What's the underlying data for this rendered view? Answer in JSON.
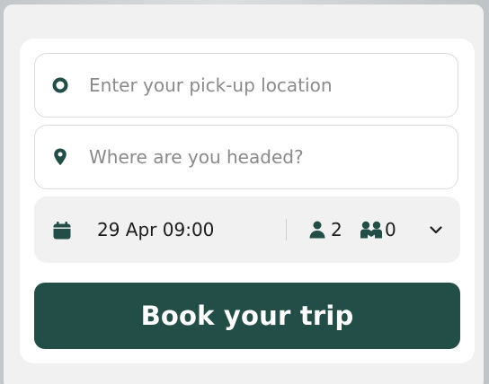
{
  "booking_form": {
    "pickup": {
      "placeholder": "Enter your pick-up location",
      "value": "",
      "icon": "origin-circle-icon"
    },
    "destination": {
      "placeholder": "Where are you headed?",
      "value": "",
      "icon": "map-pin-icon"
    },
    "trip_options": {
      "datetime": "29 Apr 09:00",
      "datetime_icon": "calendar-icon",
      "adults": "2",
      "adults_icon": "person-icon",
      "children": "0",
      "children_icon": "children-icon",
      "expand_icon": "chevron-down-icon"
    },
    "submit_label": "Book your trip"
  },
  "colors": {
    "brand": "#234e48",
    "icon": "#234e48",
    "panel_bg": "#f1f1f1",
    "card_bg": "#ffffff",
    "field_border": "#dcdcdc",
    "placeholder": "#8a8a8a",
    "text": "#1c1c1c"
  }
}
